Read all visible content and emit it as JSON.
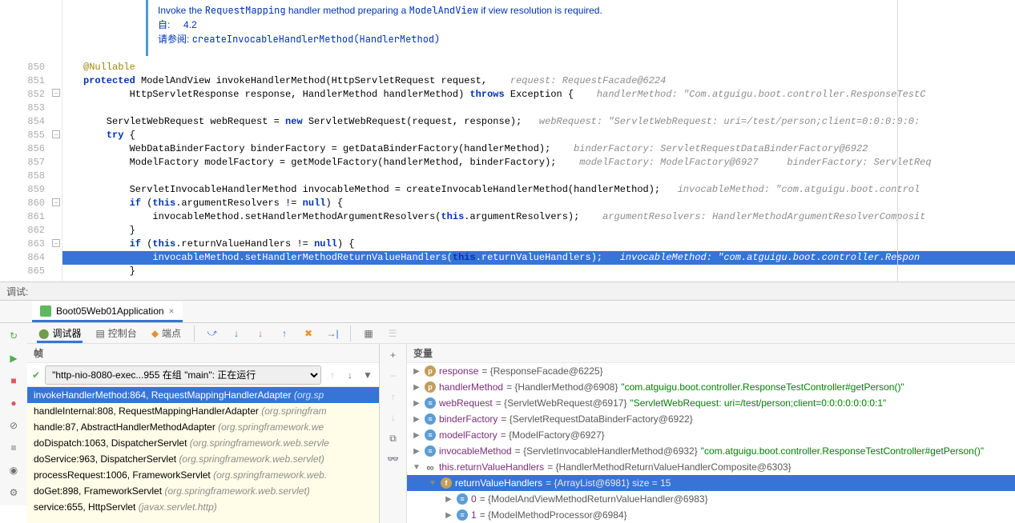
{
  "javadoc": {
    "line1_pre": "Invoke the ",
    "line1_code": "RequestMapping",
    "line1_mid": " handler method preparing a ",
    "line1_code2": "ModelAndView",
    "line1_end": " if view resolution is required.",
    "since_label": "自:",
    "since_value": "4.2",
    "see_label": "请参阅:",
    "see_link": "createInvocableHandlerMethod(HandlerMethod)"
  },
  "gutter": [
    "850",
    "851",
    "852",
    "853",
    "854",
    "855",
    "856",
    "857",
    "858",
    "859",
    "860",
    "861",
    "862",
    "863",
    "864",
    "865"
  ],
  "code": {
    "l850": "@Nullable",
    "l851_kw": "protected",
    "l851_rest": " ModelAndView invokeHandlerMethod(HttpServletRequest request,",
    "l851_cm": "    request: RequestFacade@6224",
    "l852_a": "        HttpServletResponse response, HandlerMethod handlerMethod) ",
    "l852_kw": "throws",
    "l852_b": " Exception {",
    "l852_cm": "    handlerMethod: \"Com.atguigu.boot.controller.ResponseTestC",
    "l854_a": "    ServletWebRequest webRequest = ",
    "l854_kw": "new",
    "l854_b": " ServletWebRequest(request, response);",
    "l854_cm": "   webRequest: \"ServletWebRequest: uri=/test/person;client=0:0:0:0:0:",
    "l855_kw": "try",
    "l855_b": " {",
    "l856": "        WebDataBinderFactory binderFactory = getDataBinderFactory(handlerMethod);",
    "l856_cm": "    binderFactory: ServletRequestDataBinderFactory@6922",
    "l857": "        ModelFactory modelFactory = getModelFactory(handlerMethod, binderFactory);",
    "l857_cm": "    modelFactory: ModelFactory@6927     binderFactory: ServletReq",
    "l859": "        ServletInvocableHandlerMethod invocableMethod = createInvocableHandlerMethod(handlerMethod);",
    "l859_cm": "   invocableMethod: \"com.atguigu.boot.control",
    "l860_a": "        ",
    "l860_kw": "if",
    "l860_b": " (",
    "l860_this": "this",
    "l860_c": ".argumentResolvers != ",
    "l860_null": "null",
    "l860_d": ") {",
    "l861_a": "            invocableMethod.setHandlerMethodArgumentResolvers(",
    "l861_this": "this",
    "l861_b": ".argumentResolvers);",
    "l861_cm": "    argumentResolvers: HandlerMethodArgumentResolverComposit",
    "l862": "        }",
    "l863_a": "        ",
    "l863_kw": "if",
    "l863_b": " (",
    "l863_this": "this",
    "l863_c": ".returnValueHandlers != ",
    "l863_null": "null",
    "l863_d": ") {",
    "l864_a": "            invocableMethod.setHandlerMethodReturnValueHandlers(",
    "l864_this": "this",
    "l864_b": ".returnValueHandlers);",
    "l864_cm": "   invocableMethod: \"com.atguigu.boot.controller.Respon",
    "l865": "        }"
  },
  "debug": {
    "title": "调试:",
    "run_config": "Boot05Web01Application",
    "tabs": {
      "debugger": "调试器",
      "console": "控制台",
      "breakpoints": "端点"
    },
    "frames_header": "帧",
    "vars_header": "变量",
    "thread": "\"http-nio-8080-exec...955 在组 \"main\": 正在运行",
    "stack": [
      {
        "m": "invokeHandlerMethod:864, RequestMappingHandlerAdapter",
        "pkg": "(org.sp"
      },
      {
        "m": "handleInternal:808, RequestMappingHandlerAdapter",
        "pkg": "(org.springfram"
      },
      {
        "m": "handle:87, AbstractHandlerMethodAdapter",
        "pkg": "(org.springframework.we"
      },
      {
        "m": "doDispatch:1063, DispatcherServlet",
        "pkg": "(org.springframework.web.servle"
      },
      {
        "m": "doService:963, DispatcherServlet",
        "pkg": "(org.springframework.web.servlet)"
      },
      {
        "m": "processRequest:1006, FrameworkServlet",
        "pkg": "(org.springframework.web."
      },
      {
        "m": "doGet:898, FrameworkServlet",
        "pkg": "(org.springframework.web.servlet)"
      },
      {
        "m": "service:655, HttpServlet",
        "pkg": "(javax.servlet.http)"
      }
    ],
    "vars": [
      {
        "exp": "▶",
        "ico": "p",
        "name": "response",
        "eq": " = ",
        "val": "{ResponseFacade@6225}",
        "str": ""
      },
      {
        "exp": "▶",
        "ico": "p",
        "name": "handlerMethod",
        "eq": " = ",
        "val": "{HandlerMethod@6908} ",
        "str": "\"com.atguigu.boot.controller.ResponseTestController#getPerson()\""
      },
      {
        "exp": "▶",
        "ico": "≡",
        "name": "webRequest",
        "eq": " = ",
        "val": "{ServletWebRequest@6917} ",
        "str": "\"ServletWebRequest: uri=/test/person;client=0:0:0:0:0:0:0:1\""
      },
      {
        "exp": "▶",
        "ico": "≡",
        "name": "binderFactory",
        "eq": " = ",
        "val": "{ServletRequestDataBinderFactory@6922}",
        "str": ""
      },
      {
        "exp": "▶",
        "ico": "≡",
        "name": "modelFactory",
        "eq": " = ",
        "val": "{ModelFactory@6927}",
        "str": ""
      },
      {
        "exp": "▶",
        "ico": "≡",
        "name": "invocableMethod",
        "eq": " = ",
        "val": "{ServletInvocableHandlerMethod@6932} ",
        "str": "\"com.atguigu.boot.controller.ResponseTestController#getPerson()\""
      },
      {
        "exp": "▼",
        "ico": "oo",
        "name": "this.returnValueHandlers",
        "eq": " = ",
        "val": "{HandlerMethodReturnValueHandlerComposite@6303}",
        "str": "",
        "indent": 0
      },
      {
        "exp": "▼",
        "ico": "f",
        "name": "returnValueHandlers",
        "eq": " = ",
        "val": "{ArrayList@6981}  size = 15",
        "str": "",
        "indent": 1,
        "sel": true
      },
      {
        "exp": "▶",
        "ico": "≡",
        "name": "0",
        "eq": " = ",
        "val": "{ModelAndViewMethodReturnValueHandler@6983}",
        "str": "",
        "indent": 2
      },
      {
        "exp": "▶",
        "ico": "≡",
        "name": "1",
        "eq": " = ",
        "val": "{ModelMethodProcessor@6984}",
        "str": "",
        "indent": 2
      }
    ]
  }
}
